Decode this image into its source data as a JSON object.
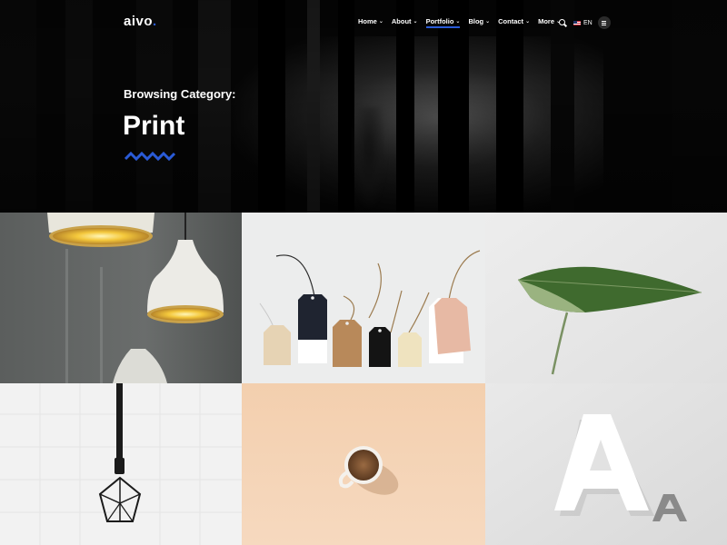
{
  "site": {
    "logo_text": "aivo",
    "logo_dot": "."
  },
  "nav": {
    "items": [
      {
        "label": "Home",
        "active": false
      },
      {
        "label": "About",
        "active": false
      },
      {
        "label": "Portfolio",
        "active": true
      },
      {
        "label": "Blog",
        "active": false
      },
      {
        "label": "Contact",
        "active": false
      },
      {
        "label": "More",
        "active": false
      }
    ],
    "language": "EN",
    "search_icon": "search-icon",
    "menu_icon": "hamburger-icon"
  },
  "hero": {
    "kicker": "Browsing Category:",
    "title": "Print"
  },
  "colors": {
    "accent": "#2a5bd7",
    "hero_bg": "#050505"
  },
  "portfolio": {
    "tiles": [
      {
        "name": "pendant-lamps"
      },
      {
        "name": "paper-tags"
      },
      {
        "name": "green-leaf"
      },
      {
        "name": "hanging-bulb"
      },
      {
        "name": "coffee-cup"
      },
      {
        "name": "letter-a"
      }
    ]
  }
}
